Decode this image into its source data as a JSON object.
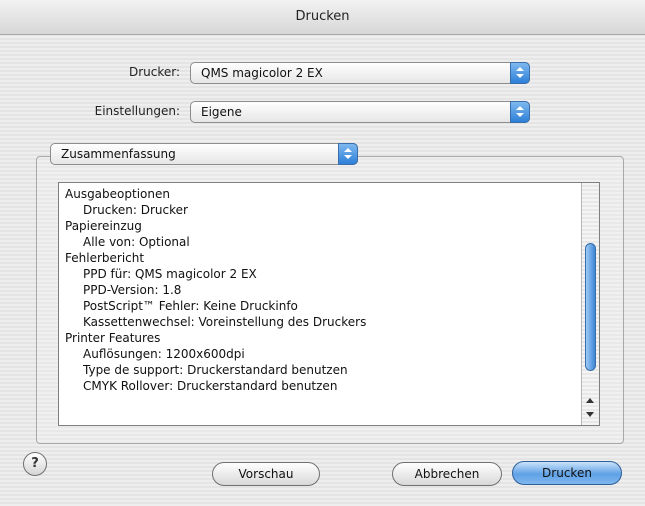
{
  "window": {
    "title": "Drucken"
  },
  "printer": {
    "label": "Drucker:",
    "value": "QMS magicolor 2 EX"
  },
  "presets": {
    "label": "Einstellungen:",
    "value": "Eigene"
  },
  "panel": {
    "value": "Zusammenfassung"
  },
  "summary": {
    "lines": [
      {
        "text": "Ausgabeoptionen",
        "indent": false
      },
      {
        "text": "Drucken:  Drucker",
        "indent": true
      },
      {
        "text": "Papiereinzug",
        "indent": false
      },
      {
        "text": "Alle von:  Optional",
        "indent": true
      },
      {
        "text": "Fehlerbericht",
        "indent": false
      },
      {
        "text": "PPD für:  QMS magicolor 2 EX",
        "indent": true
      },
      {
        "text": "PPD-Version:  1.8",
        "indent": true
      },
      {
        "text": "PostScript™ Fehler:  Keine Druckinfo",
        "indent": true
      },
      {
        "text": "Kassettenwechsel:  Voreinstellung des Druckers",
        "indent": true
      },
      {
        "text": "Printer Features",
        "indent": false
      },
      {
        "text": "Auflösungen:  1200x600dpi",
        "indent": true
      },
      {
        "text": "Type de support:  Druckerstandard benutzen",
        "indent": true
      },
      {
        "text": "CMYK Rollover:  Druckerstandard benutzen",
        "indent": true
      }
    ]
  },
  "buttons": {
    "help": "?",
    "preview": "Vorschau",
    "cancel": "Abbrechen",
    "print": "Drucken"
  },
  "colors": {
    "accent": "#3d86d8"
  }
}
